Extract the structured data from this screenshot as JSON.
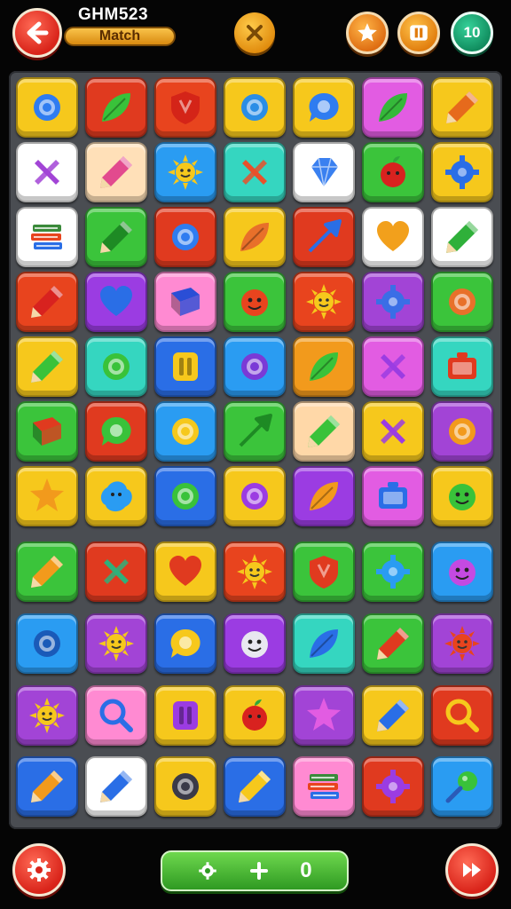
{
  "header": {
    "title": "GHM523",
    "mode_label": "Match",
    "level": "10",
    "buttons": [
      {
        "name": "back-button",
        "icon": "arrow-left-icon"
      },
      {
        "name": "close-button",
        "icon": "x-icon"
      },
      {
        "name": "star-button",
        "icon": "star-icon"
      },
      {
        "name": "pause-button",
        "icon": "pause-icon"
      }
    ]
  },
  "board": {
    "columns": 7,
    "rows": 11,
    "tiles": [
      [
        {
          "bg": "#f6c81c",
          "icon": "ring",
          "fg": "#2f7cf0"
        },
        {
          "bg": "#e03a1f",
          "icon": "leaf",
          "fg": "#39c23a"
        },
        {
          "bg": "#e8441e",
          "icon": "shield",
          "fg": "#d42418"
        },
        {
          "bg": "#f6c81c",
          "icon": "ring",
          "fg": "#2a8de6"
        },
        {
          "bg": "#f6c81c",
          "icon": "bubble",
          "fg": "#2f7cf0"
        },
        {
          "bg": "#e25ce2",
          "icon": "leaf",
          "fg": "#35b83a"
        },
        {
          "bg": "#f6c81c",
          "icon": "pencil",
          "fg": "#e66a1c"
        }
      ],
      [
        {
          "bg": "#ffffff",
          "icon": "cross",
          "fg": "#a244d6"
        },
        {
          "bg": "#ffe0b8",
          "icon": "pencil",
          "fg": "#e24a8e"
        },
        {
          "bg": "#2a9cf2",
          "icon": "sun",
          "fg": "#f6c81c"
        },
        {
          "bg": "#35d6c0",
          "icon": "cross",
          "fg": "#e8502a"
        },
        {
          "bg": "#ffffff",
          "icon": "gem",
          "fg": "#3a80f0"
        },
        {
          "bg": "#3bc43b",
          "icon": "apple",
          "fg": "#d8221f"
        },
        {
          "bg": "#f6c81c",
          "icon": "gear",
          "fg": "#2a6ee6"
        }
      ],
      [
        {
          "bg": "#ffffff",
          "icon": "books",
          "fg": "#3a8a3a"
        },
        {
          "bg": "#3bc43b",
          "icon": "pencil",
          "fg": "#1e8a24"
        },
        {
          "bg": "#e03a1f",
          "icon": "ring",
          "fg": "#2f7cf0"
        },
        {
          "bg": "#f6c81c",
          "icon": "leaf",
          "fg": "#e8702a"
        },
        {
          "bg": "#e03a1f",
          "icon": "arrow",
          "fg": "#2a6ee6"
        },
        {
          "bg": "#ffffff",
          "icon": "heart",
          "fg": "#f2a01c"
        },
        {
          "bg": "#ffffff",
          "icon": "pencil",
          "fg": "#2fb03a"
        }
      ],
      [
        {
          "bg": "#e8441e",
          "icon": "pencil",
          "fg": "#d8221f"
        },
        {
          "bg": "#9b3ce2",
          "icon": "heart",
          "fg": "#2a6ee6"
        },
        {
          "bg": "#ff8ad2",
          "icon": "book",
          "fg": "#2a4ed6"
        },
        {
          "bg": "#3bc43b",
          "icon": "face",
          "fg": "#e8441e"
        },
        {
          "bg": "#e8441e",
          "icon": "sun",
          "fg": "#f6c81c"
        },
        {
          "bg": "#a244d6",
          "icon": "gear",
          "fg": "#3a6ee6"
        },
        {
          "bg": "#3bc43b",
          "icon": "ring",
          "fg": "#e8702a"
        }
      ],
      [
        {
          "bg": "#f6c81c",
          "icon": "pencil",
          "fg": "#39c23a"
        },
        {
          "bg": "#35d6c0",
          "icon": "ring",
          "fg": "#39c23a"
        },
        {
          "bg": "#2a6ee6",
          "icon": "pause",
          "fg": "#f6c81c"
        },
        {
          "bg": "#2a9cf2",
          "icon": "ring",
          "fg": "#7a3ad6"
        },
        {
          "bg": "#f29a1c",
          "icon": "leaf",
          "fg": "#39c23a"
        },
        {
          "bg": "#e25ce2",
          "icon": "cross",
          "fg": "#9b3ce2"
        },
        {
          "bg": "#35d6c0",
          "icon": "box",
          "fg": "#e03a1f"
        }
      ],
      [
        {
          "bg": "#3bc43b",
          "icon": "book",
          "fg": "#e03a1f"
        },
        {
          "bg": "#e03a1f",
          "icon": "bubble",
          "fg": "#39c23a"
        },
        {
          "bg": "#2a9cf2",
          "icon": "ring",
          "fg": "#f6c81c"
        },
        {
          "bg": "#3bc43b",
          "icon": "arrow",
          "fg": "#1e8a24"
        },
        {
          "bg": "#ffd8a8",
          "icon": "pencil",
          "fg": "#39c23a"
        },
        {
          "bg": "#f6c81c",
          "icon": "cross",
          "fg": "#9b3ce2"
        },
        {
          "bg": "#a244d6",
          "icon": "ring",
          "fg": "#f29a1c"
        }
      ],
      [
        {
          "bg": "#f6c81c",
          "icon": "star",
          "fg": "#f29a1c"
        },
        {
          "bg": "#f6c81c",
          "icon": "blob",
          "fg": "#2a9cf2"
        },
        {
          "bg": "#2a6ee6",
          "icon": "ring",
          "fg": "#39c23a"
        },
        {
          "bg": "#f6c81c",
          "icon": "ring",
          "fg": "#9b3ce2"
        },
        {
          "bg": "#9b3ce2",
          "icon": "leaf",
          "fg": "#f29a1c"
        },
        {
          "bg": "#e25ce2",
          "icon": "box",
          "fg": "#2a6ee6"
        },
        {
          "bg": "#f6c81c",
          "icon": "face",
          "fg": "#39c23a"
        }
      ],
      [
        {
          "bg": "#3bc43b",
          "icon": "pencil",
          "fg": "#f29a1c"
        },
        {
          "bg": "#e03a1f",
          "icon": "cross",
          "fg": "#2fb07a"
        },
        {
          "bg": "#f6c81c",
          "icon": "heart",
          "fg": "#e03a1f"
        },
        {
          "bg": "#e8441e",
          "icon": "sun",
          "fg": "#f6c81c"
        },
        {
          "bg": "#3bc43b",
          "icon": "shield",
          "fg": "#e03a1f"
        },
        {
          "bg": "#3bc43b",
          "icon": "gear",
          "fg": "#2a9cf2"
        },
        {
          "bg": "#2a9cf2",
          "icon": "face",
          "fg": "#c44ae2"
        }
      ],
      [
        {
          "bg": "#2a9cf2",
          "icon": "ring",
          "fg": "#1a5ab8"
        },
        {
          "bg": "#a244d6",
          "icon": "sun",
          "fg": "#f6c81c"
        },
        {
          "bg": "#2a6ee6",
          "icon": "bubble",
          "fg": "#f6c81c"
        },
        {
          "bg": "#9b3ce2",
          "icon": "face",
          "fg": "#e8e8f0"
        },
        {
          "bg": "#35d6c0",
          "icon": "leaf",
          "fg": "#2a6ee6"
        },
        {
          "bg": "#3bc43b",
          "icon": "pencil",
          "fg": "#e03a1f"
        },
        {
          "bg": "#a244d6",
          "icon": "sun",
          "fg": "#e8441e"
        }
      ],
      [
        {
          "bg": "#a244d6",
          "icon": "sun",
          "fg": "#f6c81c"
        },
        {
          "bg": "#ff8ad2",
          "icon": "search",
          "fg": "#2a6ee6"
        },
        {
          "bg": "#f6c81c",
          "icon": "pause",
          "fg": "#9b3ce2"
        },
        {
          "bg": "#f6c81c",
          "icon": "apple",
          "fg": "#d8221f"
        },
        {
          "bg": "#a244d6",
          "icon": "star",
          "fg": "#e25ce2"
        },
        {
          "bg": "#f6c81c",
          "icon": "pencil",
          "fg": "#2a6ee6"
        },
        {
          "bg": "#e03a1f",
          "icon": "search",
          "fg": "#f6c81c"
        }
      ],
      [
        {
          "bg": "#2a6ee6",
          "icon": "pencil",
          "fg": "#f29a1c"
        },
        {
          "bg": "#ffffff",
          "icon": "pencil",
          "fg": "#2a6ee6"
        },
        {
          "bg": "#f6c81c",
          "icon": "ring",
          "fg": "#3a3a48"
        },
        {
          "bg": "#2a6ee6",
          "icon": "pencil",
          "fg": "#f6c81c"
        },
        {
          "bg": "#ff8ad2",
          "icon": "books",
          "fg": "#3a8a3a"
        },
        {
          "bg": "#e03a1f",
          "icon": "gear",
          "fg": "#9b3ce2"
        },
        {
          "bg": "#2a9cf2",
          "icon": "pin",
          "fg": "#39c23a"
        }
      ]
    ]
  },
  "footer": {
    "settings_icon": "gear-icon",
    "next_icon": "fast-forward-icon",
    "score_value": "0",
    "score_icons": [
      "gear-icon",
      "plus-icon"
    ]
  }
}
